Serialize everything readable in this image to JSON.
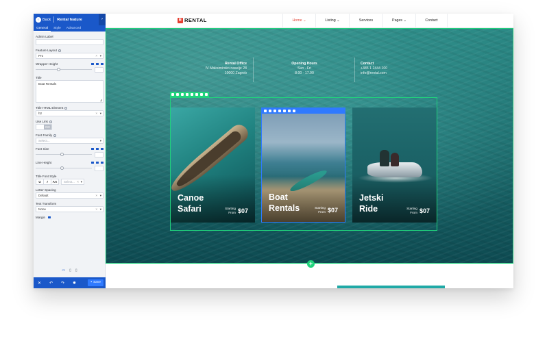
{
  "sidebar": {
    "back_label": "Back",
    "back_icon": "arrow-left-icon",
    "title": "Rental feature",
    "collapse_icon": "chevron-right-icon",
    "tabs": [
      {
        "label": "General",
        "active": true
      },
      {
        "label": "Style",
        "active": false
      },
      {
        "label": "Advanced",
        "active": false
      }
    ],
    "fields": {
      "admin_label": "Admin Label",
      "feature_layout": "Feature Layout",
      "feature_layout_value": "Pro",
      "wrapper_height": "Wrapper Height",
      "title": "Title",
      "title_value": "Boat Rentals",
      "title_html_element": "Title HTML Element",
      "title_html_element_value": "h2",
      "use_link": "Use Link",
      "use_link_toggle_on": "",
      "use_link_toggle_off": "NO",
      "font_family": "Font Family",
      "font_family_placeholder": "Select...",
      "font_size": "Font Size",
      "line_height": "Line Height",
      "title_font_style": "Title Font Style",
      "font_style_buttons": [
        "U",
        "I",
        "AA"
      ],
      "font_style_placeholder": "Select...",
      "letter_spacing": "Letter Spacing",
      "letter_spacing_value": "Default",
      "text_transform": "Text Transform",
      "text_transform_value": "None",
      "margin": "Margin"
    },
    "footer": {
      "close_icon": "close-icon",
      "undo_icon": "undo-icon",
      "redo_icon": "redo-icon",
      "settings_icon": "gear-icon",
      "save_label": "Save"
    },
    "colors": {
      "accent": "#1a58c9",
      "save": "#2f7aff"
    }
  },
  "site": {
    "logo_mark": "R",
    "logo_text": "RENTAL",
    "nav": [
      {
        "label": "Home ⌄",
        "active": true
      },
      {
        "label": "Listing ⌄",
        "active": false
      },
      {
        "label": "Services",
        "active": false
      },
      {
        "label": "Pages ⌄",
        "active": false
      },
      {
        "label": "Contact",
        "active": false
      }
    ],
    "info": {
      "office_title": "Rental Office",
      "office_line1": "IV Maksimirsko naselje 28",
      "office_line2": "10000 Zagreb",
      "hours_title": "Opening Hours",
      "hours_line1": "Sun - Fri",
      "hours_line2": "8.00 - 17.00",
      "contact_title": "Contact",
      "contact_line1": "+385 1 2444 100",
      "contact_line2": "info@rental.com"
    },
    "cards": [
      {
        "title": "Canoe Safari",
        "starting": "Starting",
        "from": "From",
        "price": "$07"
      },
      {
        "title": "Boat Rentals",
        "starting": "Starting",
        "from": "From",
        "price": "$07"
      },
      {
        "title": "Jetski Ride",
        "starting": "Starting",
        "from": "From",
        "price": "$07"
      }
    ],
    "add_section_label": "+",
    "colors": {
      "section_outline": "#20d37c",
      "selected_outline": "#2f7aff",
      "brand": "#e53c2e"
    }
  }
}
